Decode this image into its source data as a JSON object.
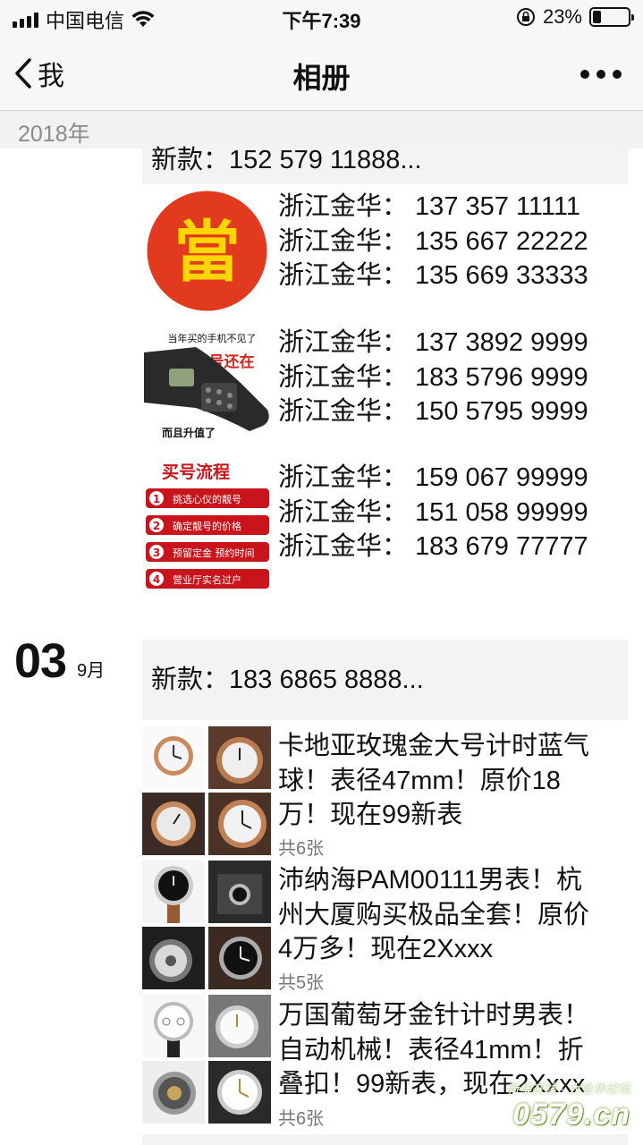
{
  "status_bar": {
    "carrier": "中国电信",
    "time": "下午7:39",
    "battery_percent": "23%",
    "battery_level": 0.23
  },
  "nav": {
    "back_label": "我",
    "title": "相册"
  },
  "year_header": "2018年",
  "entries": [
    {
      "header": "新款：152 579 11888...",
      "groups": [
        {
          "image": "当铺-logo",
          "image_text": "當",
          "lines": [
            "浙江金华：  137 357 11111",
            "浙江金华：  135 667 22222",
            "浙江金华：  135 669 33333"
          ]
        },
        {
          "image": "phone-ad",
          "image_text_top": "当年买的手机不见了",
          "image_text_mid": "号还在",
          "image_text_bottom": "而且升值了",
          "lines": [
            "浙江金华：  137 3892 9999",
            "浙江金华：  183 5796 9999",
            "浙江金华：  150 5795 9999"
          ]
        },
        {
          "image": "process-ad",
          "process_title": "买号流程",
          "process_steps": [
            "挑选心仪的靓号",
            "确定靓号的价格",
            "预留定金 预约时间",
            "营业厅实名过户"
          ],
          "lines": [
            "浙江金华：  159 067 99999",
            "浙江金华：  151 058 99999",
            "浙江金华：  183 679 77777"
          ]
        }
      ]
    },
    {
      "date_day": "03",
      "date_month": "9月",
      "header": "新款：183 6865 8888...",
      "posts": [
        {
          "lines": [
            "卡地亚玫瑰金大号计时蓝气",
            "球！表径47mm！原价18",
            "万！现在99新表"
          ],
          "count": "共6张"
        },
        {
          "lines": [
            "沛纳海PAM00111男表！杭",
            "州大厦购买极品全套！原价",
            "4万多！现在2Xxxx"
          ],
          "count": "共5张"
        },
        {
          "lines": [
            "万国葡萄牙金针计时男表！",
            "自动机械！表径41mm！折",
            "叠扣！99新表，现在2Xxxx"
          ],
          "count": "共6张"
        }
      ]
    }
  ],
  "watermark": {
    "top": "新华在线 · 大金华论坛",
    "main": "0579.cn"
  }
}
